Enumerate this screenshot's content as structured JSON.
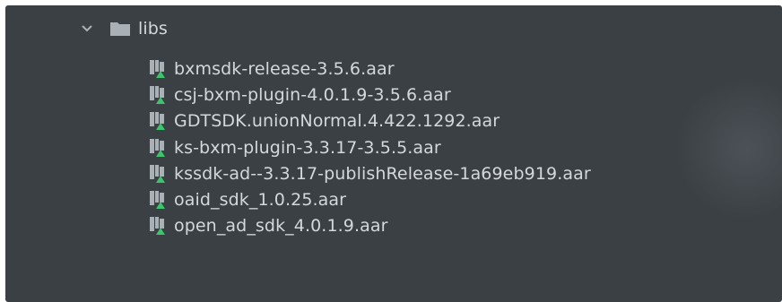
{
  "tree": {
    "folder": {
      "label": "libs",
      "expanded": true,
      "icon": "folder-icon",
      "chevron_icon": "chevron-down-icon"
    },
    "files": [
      {
        "label": "bxmsdk-release-3.5.6.aar",
        "icon": "library-archive-icon"
      },
      {
        "label": "csj-bxm-plugin-4.0.1.9-3.5.6.aar",
        "icon": "library-archive-icon"
      },
      {
        "label": "GDTSDK.unionNormal.4.422.1292.aar",
        "icon": "library-archive-icon"
      },
      {
        "label": "ks-bxm-plugin-3.3.17-3.5.5.aar",
        "icon": "library-archive-icon"
      },
      {
        "label": "kssdk-ad--3.3.17-publishRelease-1a69eb919.aar",
        "icon": "library-archive-icon"
      },
      {
        "label": "oaid_sdk_1.0.25.aar",
        "icon": "library-archive-icon"
      },
      {
        "label": "open_ad_sdk_4.0.1.9.aar",
        "icon": "library-archive-icon"
      }
    ]
  },
  "colors": {
    "background": "#3b4045",
    "text": "#d4d8dc",
    "icon_gray": "#a9b0b6",
    "icon_accent": "#3ec46d"
  }
}
